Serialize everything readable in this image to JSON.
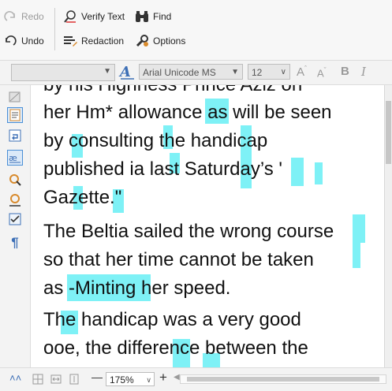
{
  "ribbon": {
    "redo_label": "Redo",
    "undo_label": "Undo",
    "verify_text_label": "Verify Text",
    "redaction_label": "Redaction",
    "find_label": "Find",
    "options_label": "Options"
  },
  "format_bar": {
    "style_value": "",
    "font_icon": "font-icon",
    "font_value": "Arial Unicode MS",
    "size_value": "12",
    "grow_label": "A",
    "shrink_label": "A",
    "bold_label": "B",
    "italic_label": "I"
  },
  "document": {
    "lines": [
      "by his Highness Prince Aziz on",
      "her Hm* allowance as will be seen",
      "by consulting the handicap",
      "published ia last Saturday’s '",
      "Gazette.\"",
      "The Beltia sailed the wrong course",
      "so that her time cannot be taken",
      "as -Minting her speed.",
      "The handicap was a very good",
      "ooe, the difference between the"
    ]
  },
  "bottom_bar": {
    "zoom_value": "175%",
    "minus_label": "—",
    "plus_label": "+"
  },
  "colors": {
    "highlight": "#7ef1f6",
    "accent": "#3d6fb6",
    "spell_error": "#d11"
  }
}
